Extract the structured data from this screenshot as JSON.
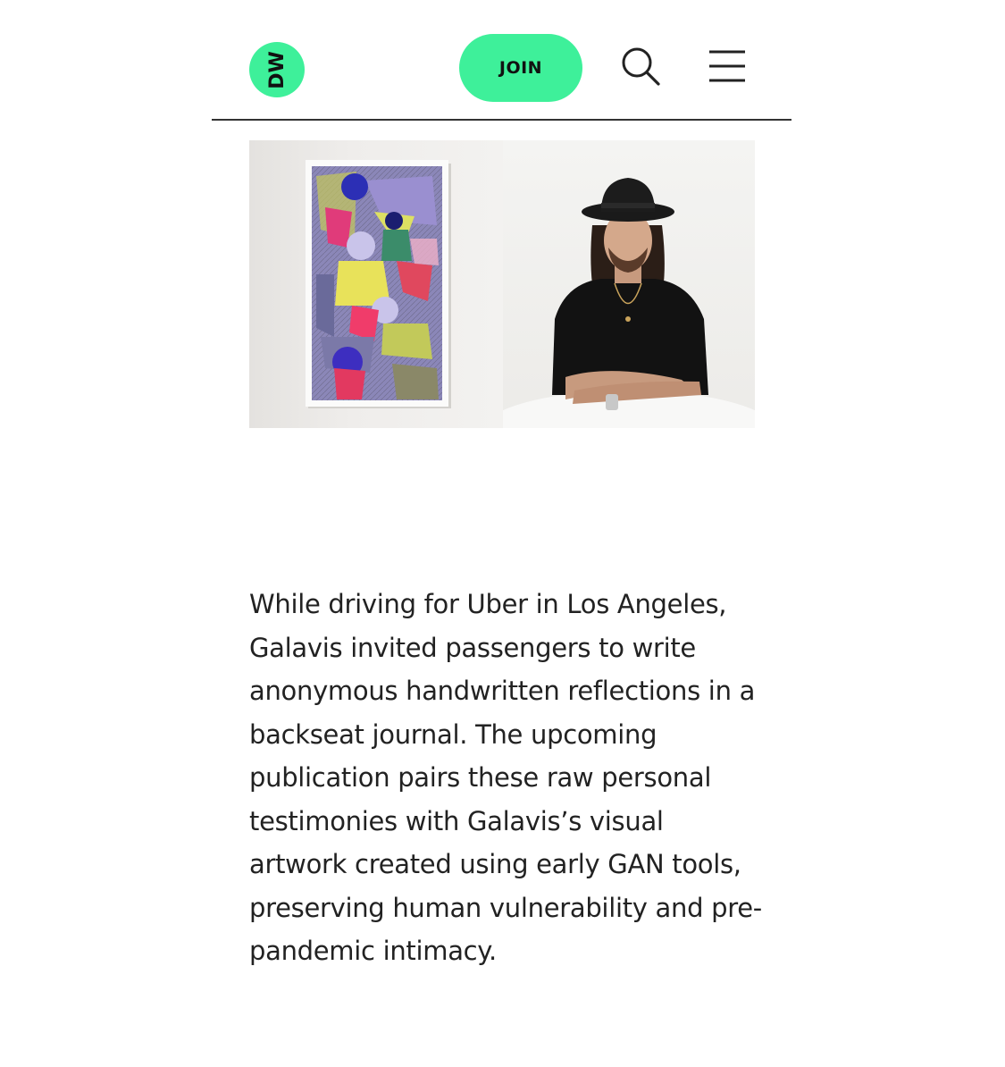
{
  "header": {
    "logo_text": "DW",
    "join_label": "JOIN",
    "search_icon": "search-icon",
    "menu_icon": "hamburger-menu-icon"
  },
  "colors": {
    "accent": "#3ef09a",
    "text": "#222222",
    "divider": "#333333"
  },
  "hero": {
    "left_image": "framed-artwork-image",
    "right_image": "artist-portrait-image"
  },
  "article": {
    "paragraph": "While driving for Uber in Los Angeles, Galavis invited passengers to write anonymous handwritten reflections in a backseat journal. The upcoming publication pairs these raw personal testimonies with Galavis’s visual artwork created using early GAN tools, preserving human vulnerability and pre-pandemic intimacy."
  }
}
